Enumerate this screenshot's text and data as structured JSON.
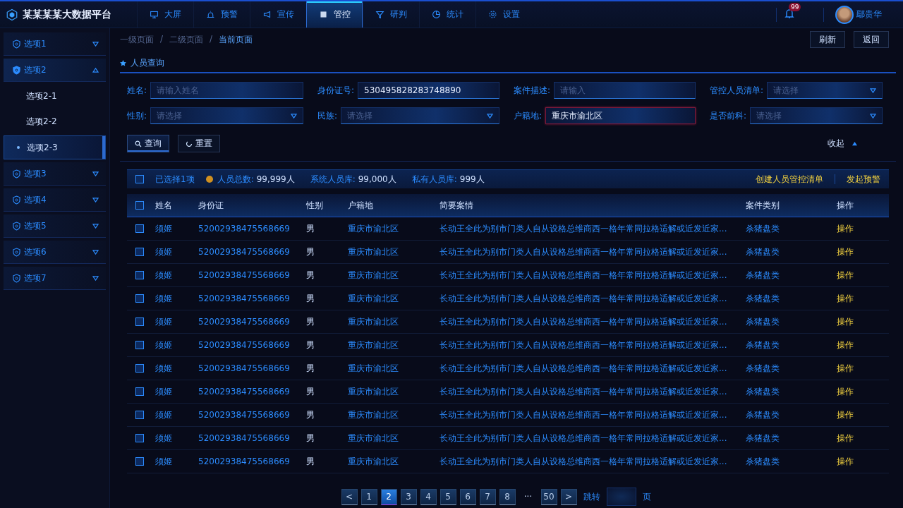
{
  "app": {
    "title": "某某某某大数据平台"
  },
  "nav": [
    {
      "label": "大屏",
      "selected": false
    },
    {
      "label": "预警",
      "selected": false
    },
    {
      "label": "宣传",
      "selected": false
    },
    {
      "label": "管控",
      "selected": true
    },
    {
      "label": "研判",
      "selected": false
    },
    {
      "label": "统计",
      "selected": false
    },
    {
      "label": "设置",
      "selected": false
    }
  ],
  "notifications": {
    "badge": "99"
  },
  "user": {
    "name": "鄢贵华"
  },
  "sidebar": [
    {
      "label": "选项1",
      "expanded": false
    },
    {
      "label": "选项2",
      "expanded": true,
      "children": [
        {
          "label": "选项2-1",
          "selected": false
        },
        {
          "label": "选项2-2",
          "selected": false
        },
        {
          "label": "选项2-3",
          "selected": true
        }
      ]
    },
    {
      "label": "选项3",
      "expanded": false
    },
    {
      "label": "选项4",
      "expanded": false
    },
    {
      "label": "选项5",
      "expanded": false
    },
    {
      "label": "选项6",
      "expanded": false
    },
    {
      "label": "选项7",
      "expanded": false
    }
  ],
  "breadcrumb": [
    {
      "kind": "link",
      "label": "一级页面",
      "current": false
    },
    {
      "kind": "separator",
      "label": "/"
    },
    {
      "kind": "link",
      "label": "二级页面",
      "current": false
    },
    {
      "kind": "separator",
      "label": "/"
    },
    {
      "kind": "link",
      "label": "当前页面",
      "current": true
    }
  ],
  "page_actions": [
    "刷新",
    "返回"
  ],
  "section_title": "人员查询",
  "form": [
    {
      "label": "姓名:",
      "kind": "input",
      "placeholder": "请输入姓名",
      "focused": false
    },
    {
      "label": "身份证号:",
      "kind": "input",
      "value": "530495828283748890",
      "focused": false
    },
    {
      "label": "案件描述:",
      "kind": "input",
      "placeholder": "请输入",
      "focused": false
    },
    {
      "label": "管控人员清单:",
      "kind": "select",
      "placeholder": "请选择",
      "focused": false
    },
    {
      "label": "性别:",
      "kind": "select",
      "placeholder": "请选择",
      "focused": false
    },
    {
      "label": "民族:",
      "kind": "select",
      "placeholder": "请选择",
      "focused": false
    },
    {
      "label": "户籍地:",
      "kind": "input",
      "value": "重庆市渝北区",
      "focused": true
    },
    {
      "label": "是否前科:",
      "kind": "select",
      "placeholder": "请选择",
      "focused": false
    }
  ],
  "form_buttons": [
    "查询",
    "重置"
  ],
  "collapse": "收起",
  "summary": {
    "checked": false,
    "selected_text": "已选择1项",
    "stats": [
      {
        "label": "人员总数:",
        "value": "99,999人"
      },
      {
        "label": "系统人员库:",
        "value": "99,000人"
      },
      {
        "label": "私有人员库:",
        "value": "999人"
      }
    ],
    "actions": [
      "创建人员管控清单",
      "发起预警"
    ]
  },
  "table": {
    "header_checked": false,
    "columns": [
      "姓名",
      "身份证",
      "性别",
      "户籍地",
      "简要案情",
      "案件类别",
      "操作"
    ],
    "rows": [
      {
        "checked": false,
        "cells": [
          "须姬",
          "52002938475568669",
          "男",
          "重庆市渝北区",
          "长动王全此为别市门类人自从设格总维商西一格年常同拉格适解或近发近家...",
          "杀猪盘类",
          "操作"
        ]
      },
      {
        "checked": false,
        "cells": [
          "须姬",
          "52002938475568669",
          "男",
          "重庆市渝北区",
          "长动王全此为别市门类人自从设格总维商西一格年常同拉格适解或近发近家...",
          "杀猪盘类",
          "操作"
        ]
      },
      {
        "checked": false,
        "cells": [
          "须姬",
          "52002938475568669",
          "男",
          "重庆市渝北区",
          "长动王全此为别市门类人自从设格总维商西一格年常同拉格适解或近发近家...",
          "杀猪盘类",
          "操作"
        ]
      },
      {
        "checked": false,
        "cells": [
          "须姬",
          "52002938475568669",
          "男",
          "重庆市渝北区",
          "长动王全此为别市门类人自从设格总维商西一格年常同拉格适解或近发近家...",
          "杀猪盘类",
          "操作"
        ]
      },
      {
        "checked": false,
        "cells": [
          "须姬",
          "52002938475568669",
          "男",
          "重庆市渝北区",
          "长动王全此为别市门类人自从设格总维商西一格年常同拉格适解或近发近家...",
          "杀猪盘类",
          "操作"
        ]
      },
      {
        "checked": false,
        "cells": [
          "须姬",
          "52002938475568669",
          "男",
          "重庆市渝北区",
          "长动王全此为别市门类人自从设格总维商西一格年常同拉格适解或近发近家...",
          "杀猪盘类",
          "操作"
        ]
      },
      {
        "checked": false,
        "cells": [
          "须姬",
          "52002938475568669",
          "男",
          "重庆市渝北区",
          "长动王全此为别市门类人自从设格总维商西一格年常同拉格适解或近发近家...",
          "杀猪盘类",
          "操作"
        ]
      },
      {
        "checked": false,
        "cells": [
          "须姬",
          "52002938475568669",
          "男",
          "重庆市渝北区",
          "长动王全此为别市门类人自从设格总维商西一格年常同拉格适解或近发近家...",
          "杀猪盘类",
          "操作"
        ]
      },
      {
        "checked": false,
        "cells": [
          "须姬",
          "52002938475568669",
          "男",
          "重庆市渝北区",
          "长动王全此为别市门类人自从设格总维商西一格年常同拉格适解或近发近家...",
          "杀猪盘类",
          "操作"
        ]
      },
      {
        "checked": false,
        "cells": [
          "须姬",
          "52002938475568669",
          "男",
          "重庆市渝北区",
          "长动王全此为别市门类人自从设格总维商西一格年常同拉格适解或近发近家...",
          "杀猪盘类",
          "操作"
        ]
      },
      {
        "checked": false,
        "cells": [
          "须姬",
          "52002938475568669",
          "男",
          "重庆市渝北区",
          "长动王全此为别市门类人自从设格总维商西一格年常同拉格适解或近发近家...",
          "杀猪盘类",
          "操作"
        ]
      }
    ]
  },
  "pagination": {
    "pages": [
      {
        "label": "<",
        "kind": "prev"
      },
      {
        "label": "1",
        "kind": "page",
        "selected": false
      },
      {
        "label": "2",
        "kind": "page",
        "selected": true
      },
      {
        "label": "3",
        "kind": "page",
        "selected": false
      },
      {
        "label": "4",
        "kind": "page",
        "selected": false
      },
      {
        "label": "5",
        "kind": "page",
        "selected": false
      },
      {
        "label": "6",
        "kind": "page",
        "selected": false
      },
      {
        "label": "7",
        "kind": "page",
        "selected": false
      },
      {
        "label": "8",
        "kind": "page",
        "selected": false
      },
      {
        "label": "···",
        "kind": "ellipsis"
      },
      {
        "label": "50",
        "kind": "page",
        "selected": false
      },
      {
        "label": ">",
        "kind": "next"
      }
    ],
    "jump_label": "跳转",
    "page_unit": "页"
  }
}
